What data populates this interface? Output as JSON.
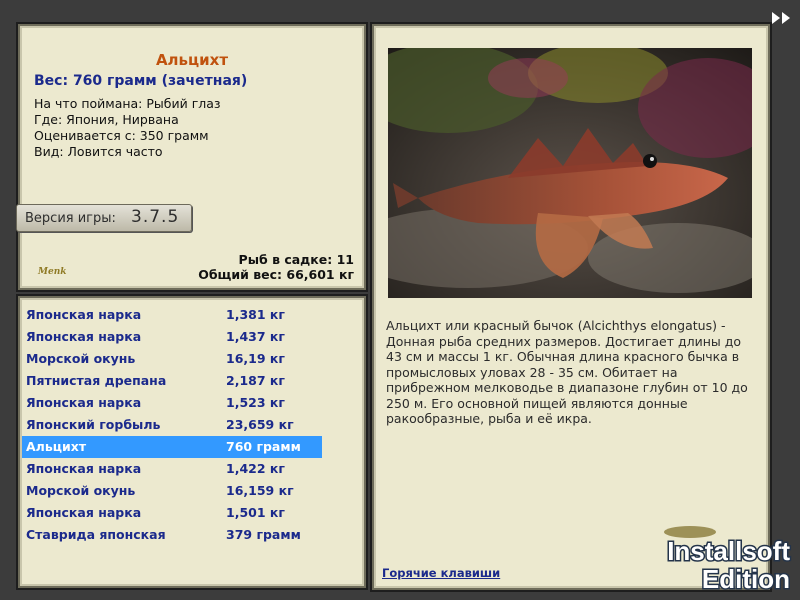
{
  "fish": {
    "name": "Альцихт",
    "weight_line": "Вес: 760 грамм (зачетная)",
    "caught_with": "На что поймана: Рыбий глаз",
    "location": "Где: Япония, Нирвана",
    "valued_from": "Оценивается с: 350 грамм",
    "frequency": "Вид: Ловится часто"
  },
  "version": {
    "label": "Версия игры:",
    "number": "3.7.5"
  },
  "logo_text": "Menk",
  "stats": {
    "in_keepnet": "Рыб в садке: 11",
    "total_weight": "Общий вес: 66,601 кг"
  },
  "catch_list": [
    {
      "name": "Японская нарка",
      "weight": "1,381 кг"
    },
    {
      "name": "Японская нарка",
      "weight": "1,437 кг"
    },
    {
      "name": "Морской окунь",
      "weight": "16,19 кг"
    },
    {
      "name": "Пятнистая дрепана",
      "weight": "2,187 кг"
    },
    {
      "name": "Японская нарка",
      "weight": "1,523 кг"
    },
    {
      "name": "Японский горбыль",
      "weight": "23,659 кг"
    },
    {
      "name": "Альцихт",
      "weight": "760 грамм"
    },
    {
      "name": "Японская нарка",
      "weight": "1,422 кг"
    },
    {
      "name": "Морской окунь",
      "weight": "16,159 кг"
    },
    {
      "name": "Японская нарка",
      "weight": "1,501 кг"
    },
    {
      "name": "Ставрида японская",
      "weight": "379 грамм"
    }
  ],
  "selected_index": 6,
  "description": "Альцихт или красный бычок (Alcichthys elongatus) - Донная рыба средних размеров. Достигает длины до 43 см и массы 1 кг. Обычная длина красного бычка в промысловых уловах 28 - 35 см. Обитает на прибрежном мелководье в диапазоне глубин от 10 до 250 м. Его основной пищей являются донные ракообразные, рыба и её икра.",
  "hotkeys_label": "Горячие клавиши",
  "watermark": {
    "line1": "Installsoft",
    "line2": "Edition"
  },
  "icons": {
    "next": "double-arrow-right-icon",
    "photo": "fish-photo"
  },
  "colors": {
    "title": "#c0520e",
    "accent_text": "#1b2a8c",
    "selection": "#3399ff",
    "panel": "#ece9cf"
  }
}
